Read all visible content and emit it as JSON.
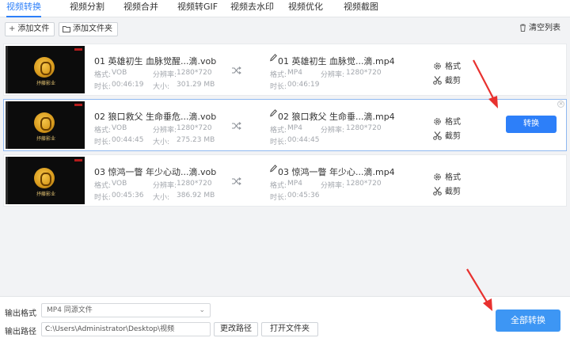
{
  "tabs": [
    {
      "label": "视频转换",
      "active": true
    },
    {
      "label": "视频分割"
    },
    {
      "label": "视频合并"
    },
    {
      "label": "视频转GIF"
    },
    {
      "label": "视频去水印"
    },
    {
      "label": "视频优化"
    },
    {
      "label": "视频截图"
    }
  ],
  "toolbar": {
    "add_file": "添加文件",
    "add_folder": "添加文件夹",
    "clear_list": "清空列表"
  },
  "thumbnail_caption": "抒藤影业",
  "labels": {
    "format": "格式:",
    "resolution": "分辨率:",
    "duration": "时长:",
    "size": "大小:",
    "format_action": "格式",
    "cut_action": "截剪",
    "convert": "转换"
  },
  "files": [
    {
      "source_name": "01 英雄初生 血脉觉醒...滴.vob",
      "source_format": "VOB",
      "source_resolution": "1280*720",
      "source_duration": "00:46:19",
      "source_size": "301.29 MB",
      "output_name": "01 英雄初生 血脉觉...滴.mp4",
      "output_format": "MP4",
      "output_resolution": "1280*720",
      "output_duration": "00:46:19"
    },
    {
      "source_name": "02 狼口救父 生命垂危...滴.vob",
      "source_format": "VOB",
      "source_resolution": "1280*720",
      "source_duration": "00:44:45",
      "source_size": "275.23 MB",
      "output_name": "02 狼口救父 生命垂...滴.mp4",
      "output_format": "MP4",
      "output_resolution": "1280*720",
      "output_duration": "00:44:45"
    },
    {
      "source_name": "03 惊鸿一瞥 年少心动...滴.vob",
      "source_format": "VOB",
      "source_resolution": "1280*720",
      "source_duration": "00:45:36",
      "source_size": "386.92 MB",
      "output_name": "03 惊鸿一瞥 年少心...滴.mp4",
      "output_format": "MP4",
      "output_resolution": "1280*720",
      "output_duration": "00:45:36"
    }
  ],
  "bottom": {
    "output_format_label": "输出格式",
    "output_format_value": "MP4  同源文件",
    "output_path_label": "输出路径",
    "output_path_value": "C:\\Users\\Administrator\\Desktop\\视频",
    "change_path": "更改路径",
    "open_folder": "打开文件夹",
    "convert_all": "全部转换"
  },
  "colors": {
    "accent": "#2d7ff9",
    "arrow": "#e8312f"
  }
}
